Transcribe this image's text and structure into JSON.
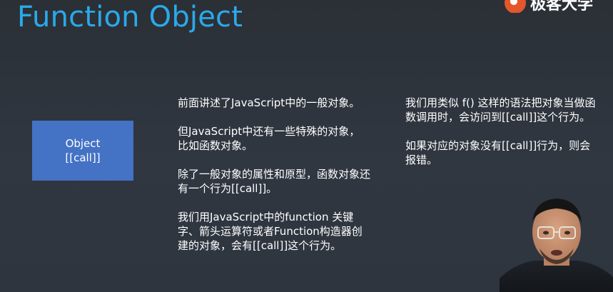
{
  "slide": {
    "title": "Function Object",
    "logo_text": "极客大学",
    "object_box": {
      "line1": "Object",
      "line2": "[[call]]"
    },
    "left_paragraphs": [
      "前面讲述了JavaScript中的一般对象。",
      "但JavaScript中还有一些特殊的对象，比如函数对象。",
      "除了一般对象的属性和原型，函数对象还有一个行为[[call]]。",
      "我们用JavaScript中的function 关键字、箭头运算符或者Function构造器创建的对象，会有[[call]]这个行为。"
    ],
    "right_paragraphs": [
      "我们用类似 f() 这样的语法把对象当做函数调用时，会访问到[[call]]这个行为。",
      "如果对应的对象没有[[call]]行为，则会报错。"
    ]
  },
  "colors": {
    "title": "#2aa9eb",
    "box": "#4472c4",
    "background": "#2f353d",
    "logo": "#e2572c"
  }
}
